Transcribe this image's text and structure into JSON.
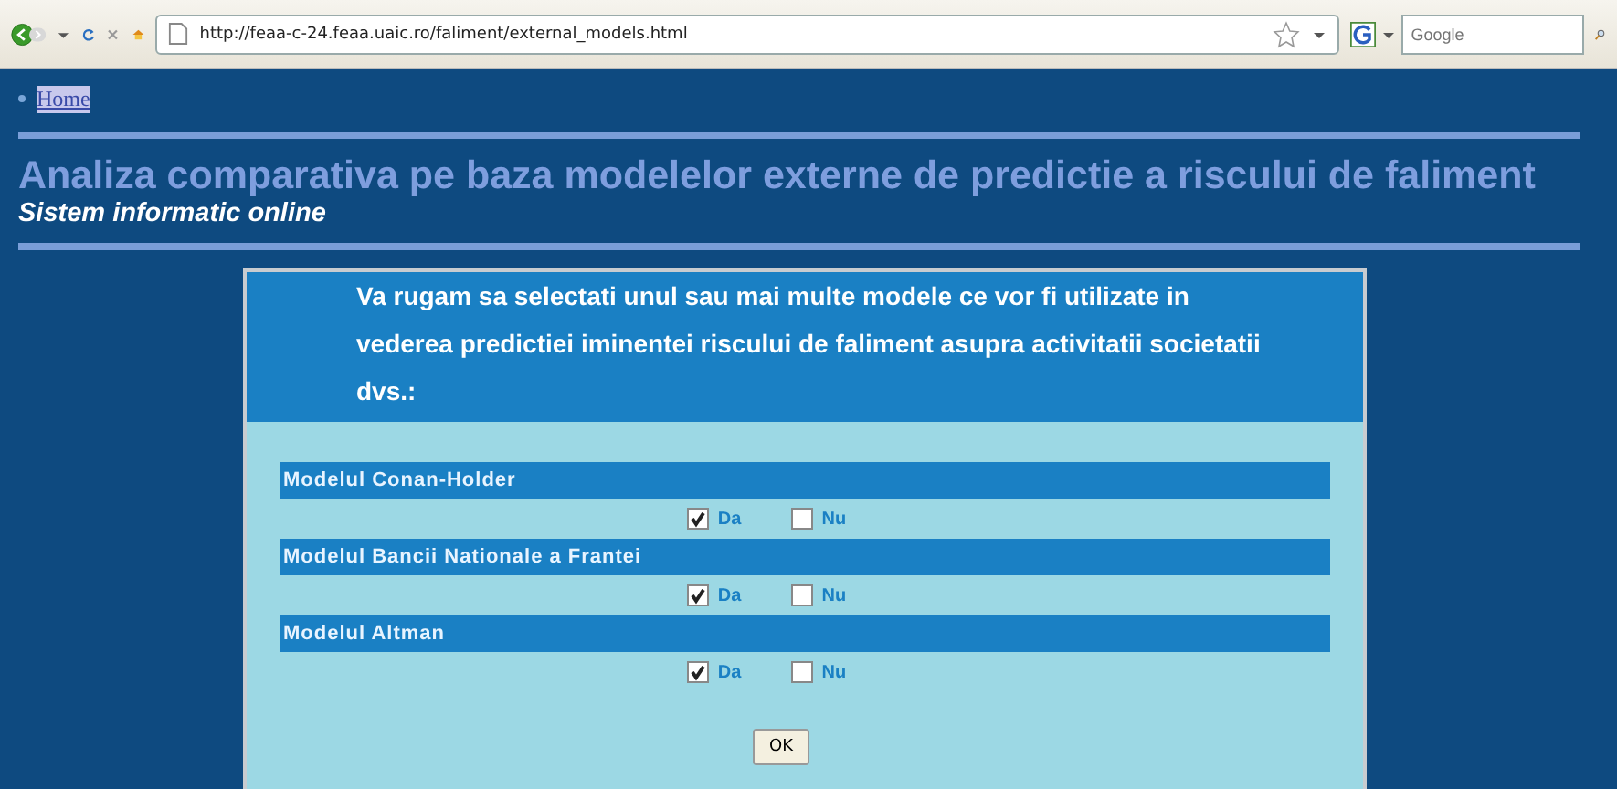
{
  "browser": {
    "url": "http://feaa-c-24.feaa.uaic.ro/faliment/external_models.html",
    "search_placeholder": "Google"
  },
  "nav": {
    "link": "Home"
  },
  "header": {
    "title": "Analiza comparativa pe baza modelelor externe de predictie a riscului de faliment",
    "subtitle": "Sistem informatic online"
  },
  "form": {
    "intro": "Va rugam sa selectati unul sau mai multe modele ce vor fi utilizate in vederea predictiei iminentei riscului de faliment asupra activitatii societatii dvs.:",
    "models": [
      {
        "name": "Modelul Conan-Holder",
        "options": [
          {
            "label": "Da",
            "checked": true
          },
          {
            "label": "Nu",
            "checked": false
          }
        ]
      },
      {
        "name": "Modelul Bancii Nationale a Frantei",
        "options": [
          {
            "label": "Da",
            "checked": true
          },
          {
            "label": "Nu",
            "checked": false
          }
        ]
      },
      {
        "name": "Modelul Altman",
        "options": [
          {
            "label": "Da",
            "checked": true
          },
          {
            "label": "Nu",
            "checked": false
          }
        ]
      }
    ],
    "button": "OK"
  }
}
